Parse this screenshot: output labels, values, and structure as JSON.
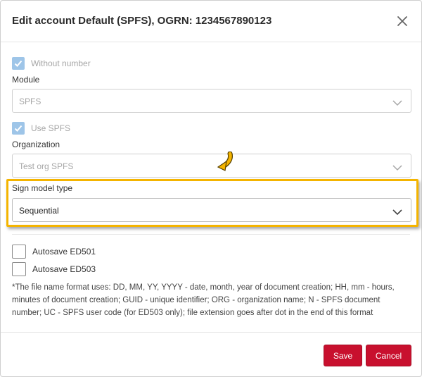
{
  "dialog": {
    "title": "Edit account Default (SPFS), OGRN: 1234567890123"
  },
  "without_number": {
    "label": "Without number",
    "checked": true,
    "disabled": true
  },
  "module": {
    "label": "Module",
    "value": "SPFS"
  },
  "use_spfs": {
    "label": "Use SPFS",
    "checked": true,
    "disabled": true
  },
  "organization": {
    "label": "Organization",
    "value": "Test org SPFS"
  },
  "sign_model": {
    "label": "Sign model type",
    "value": "Sequential"
  },
  "autosave_ed501": {
    "label": "Autosave ED501",
    "checked": false
  },
  "autosave_ed503": {
    "label": "Autosave ED503",
    "checked": false
  },
  "note": "*The file name format uses: DD, MM, YY, YYYY - date, month, year of document creation; HH, mm - hours, minutes of document creation; GUID - unique identifier; ORG - organization name; N - SPFS document number; UC - SPFS user code (for ED503 only); file extension goes after dot in the end of this format",
  "buttons": {
    "save": "Save",
    "cancel": "Cancel"
  },
  "colors": {
    "accent": "#c8102e",
    "highlight": "#f4b400",
    "checkbox_disabled": "#9ec5e8"
  }
}
